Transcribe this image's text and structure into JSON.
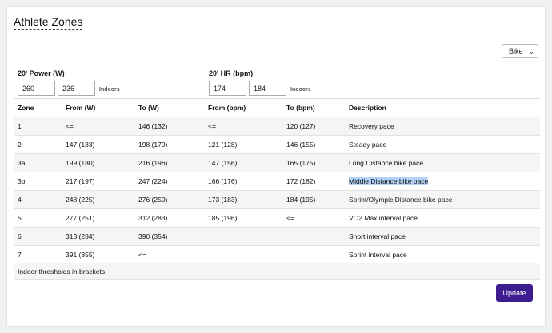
{
  "page": {
    "title": "Athlete Zones"
  },
  "sport_select": {
    "value": "Bike"
  },
  "power": {
    "label": "20' Power (W)",
    "outdoor": "260",
    "indoor": "236",
    "note": "Indoors"
  },
  "hr": {
    "label": "20' HR (bpm)",
    "outdoor": "174",
    "indoor": "184",
    "note": "Indoors"
  },
  "table": {
    "headers": [
      "Zone",
      "From (W)",
      "To (W)",
      "From (bpm)",
      "To (bpm)",
      "Description"
    ],
    "rows": [
      [
        "1",
        "<=",
        "146 (132)",
        "<=",
        "120 (127)",
        "Recovery pace"
      ],
      [
        "2",
        "147 (133)",
        "198 (179)",
        "121 (128)",
        "146 (155)",
        "Steady pace"
      ],
      [
        "3a",
        "199 (180)",
        "216 (196)",
        "147 (156)",
        "165 (175)",
        "Long Distance bike pace"
      ],
      [
        "3b",
        "217 (197)",
        "247 (224)",
        "166 (176)",
        "172 (182)",
        "Middle Distance bike pace"
      ],
      [
        "4",
        "248 (225)",
        "276 (250)",
        "173 (183)",
        "184 (195)",
        "Sprint/Olympic Distance bike pace"
      ],
      [
        "5",
        "277 (251)",
        "312 (283)",
        "185 (196)",
        "<=",
        "VO2 Max interval pace"
      ],
      [
        "6",
        "313 (284)",
        "390 (354)",
        "",
        "",
        "Short interval pace"
      ],
      [
        "7",
        "391 (355)",
        "<=",
        "",
        "",
        "Sprint interval pace"
      ]
    ],
    "footnote": "Indoor thresholds in brackets"
  },
  "update_button": {
    "label": "Update"
  },
  "colors": {
    "accent": "#3d1c8f",
    "selection": "#b3d2f7"
  }
}
